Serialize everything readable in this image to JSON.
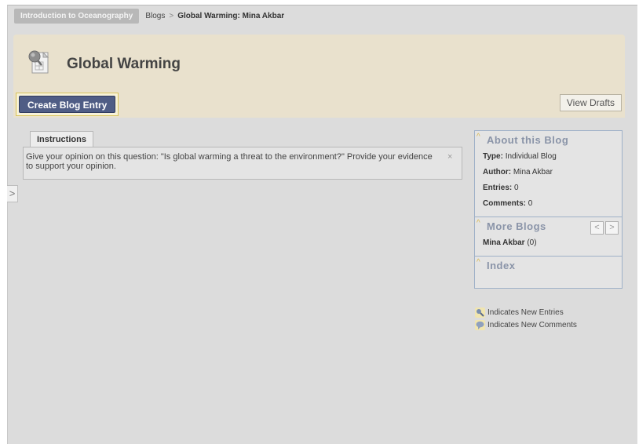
{
  "breadcrumb": {
    "course": "Introduction to Oceanography",
    "section": "Blogs",
    "separator": ">",
    "current": "Global Warming: Mina Akbar"
  },
  "header": {
    "title": "Global Warming",
    "create_label": "Create Blog Entry",
    "drafts_label": "View Drafts"
  },
  "left_tab": {
    "glyph": ">"
  },
  "instructions": {
    "tab_label": "Instructions",
    "text": "Give your opinion on this question: \"Is global warming a threat to the environment?\" Provide your evidence to support your opinion.",
    "close_glyph": "×"
  },
  "sidebar": {
    "about": {
      "title": "About this Blog",
      "type_label": "Type:",
      "type_value": "Individual Blog",
      "author_label": "Author:",
      "author_value": "Mina Akbar",
      "entries_label": "Entries:",
      "entries_value": "0",
      "comments_label": "Comments:",
      "comments_value": "0"
    },
    "more": {
      "title": "More Blogs",
      "prev_glyph": "<",
      "next_glyph": ">",
      "blog_name": "Mina Akbar",
      "blog_count": "(0)"
    },
    "index": {
      "title": "Index"
    },
    "caret_glyph": "^"
  },
  "legend": {
    "new_entries": "Indicates New Entries",
    "new_comments": "Indicates New Comments"
  },
  "colors": {
    "header_bg": "#e9e1cd",
    "button": "#4f5d85",
    "sidebar_border": "#9fb1c8",
    "sidebar_title": "#8a94a8"
  }
}
